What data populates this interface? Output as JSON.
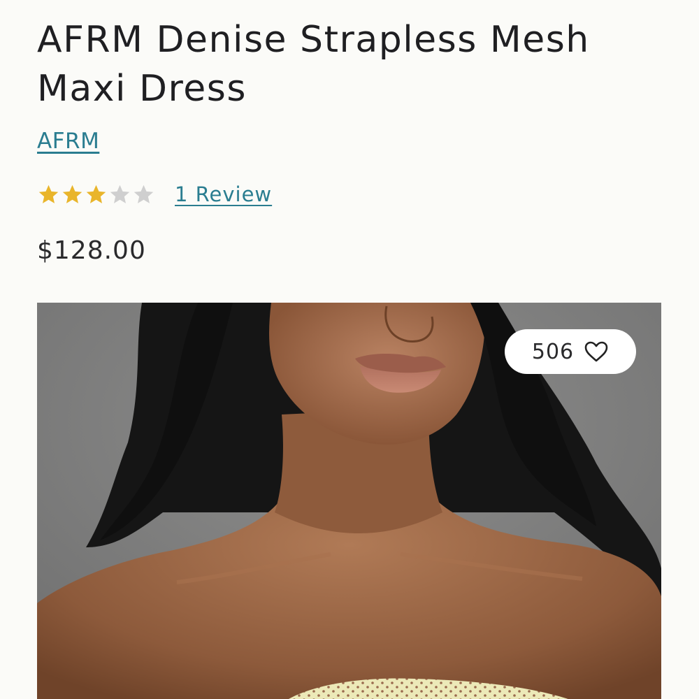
{
  "product": {
    "title": "AFRM Denise Strapless Mesh Maxi Dress",
    "brand_label": "AFRM",
    "rating": {
      "value": 3,
      "max": 5,
      "filled_color": "#e9b52b",
      "empty_color": "#cfcfcf",
      "review_link_label": "1 Review"
    },
    "price": "$128.00"
  },
  "image": {
    "like_count": "506",
    "like_icon": "heart-outline-icon"
  },
  "colors": {
    "link": "#2a7d90",
    "background": "#fbfbf8"
  }
}
